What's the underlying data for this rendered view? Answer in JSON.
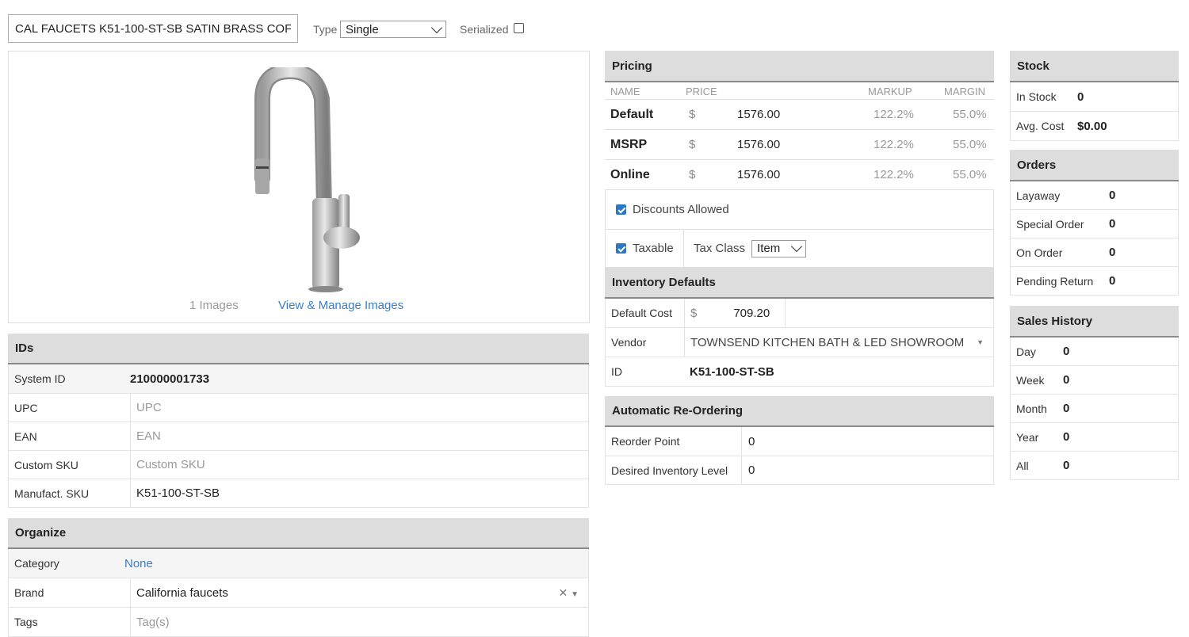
{
  "header": {
    "description_value": "CAL FAUCETS K51-100-ST-SB SATIN BRASS COF",
    "type_label": "Type",
    "type_value": "Single",
    "serialized_label": "Serialized"
  },
  "images": {
    "count_text": "1 Images",
    "manage_link": "View & Manage Images"
  },
  "ids": {
    "title": "IDs",
    "rows": [
      {
        "label": "System ID",
        "value": "210000001733"
      },
      {
        "label": "UPC",
        "placeholder": "UPC"
      },
      {
        "label": "EAN",
        "placeholder": "EAN"
      },
      {
        "label": "Custom SKU",
        "placeholder": "Custom SKU"
      },
      {
        "label": "Manufact. SKU",
        "value": "K51-100-ST-SB"
      }
    ]
  },
  "organize": {
    "title": "Organize",
    "category_label": "Category",
    "category_value": "None",
    "brand_label": "Brand",
    "brand_value": "California faucets",
    "tags_label": "Tags",
    "tags_placeholder": "Tag(s)"
  },
  "pricing": {
    "title": "Pricing",
    "columns": {
      "name": "NAME",
      "price": "PRICE",
      "markup": "MARKUP",
      "margin": "MARGIN"
    },
    "rows": [
      {
        "name": "Default",
        "currency": "$",
        "price": "1576.00",
        "markup": "122.2%",
        "margin": "55.0%"
      },
      {
        "name": "MSRP",
        "currency": "$",
        "price": "1576.00",
        "markup": "122.2%",
        "margin": "55.0%"
      },
      {
        "name": "Online",
        "currency": "$",
        "price": "1576.00",
        "markup": "122.2%",
        "margin": "55.0%"
      }
    ],
    "discounts_label": "Discounts Allowed",
    "taxable_label": "Taxable",
    "tax_class_label": "Tax Class",
    "tax_class_value": "Item"
  },
  "inventory_defaults": {
    "title": "Inventory Defaults",
    "default_cost_label": "Default Cost",
    "currency": "$",
    "default_cost_value": "709.20",
    "vendor_label": "Vendor",
    "vendor_value": "TOWNSEND KITCHEN BATH & LED SHOWROOM",
    "id_label": "ID",
    "id_value": "K51-100-ST-SB"
  },
  "reorder": {
    "title": "Automatic Re-Ordering",
    "reorder_point_label": "Reorder Point",
    "reorder_point_value": "0",
    "desired_label": "Desired Inventory Level",
    "desired_value": "0"
  },
  "stock": {
    "title": "Stock",
    "in_stock_label": "In Stock",
    "in_stock_value": "0",
    "avg_cost_label": "Avg. Cost",
    "avg_cost_value": "$0.00"
  },
  "orders": {
    "title": "Orders",
    "rows": [
      {
        "label": "Layaway",
        "value": "0"
      },
      {
        "label": "Special Order",
        "value": "0"
      },
      {
        "label": "On Order",
        "value": "0"
      },
      {
        "label": "Pending Return",
        "value": "0"
      }
    ]
  },
  "sales_history": {
    "title": "Sales History",
    "rows": [
      {
        "label": "Day",
        "value": "0"
      },
      {
        "label": "Week",
        "value": "0"
      },
      {
        "label": "Month",
        "value": "0"
      },
      {
        "label": "Year",
        "value": "0"
      },
      {
        "label": "All",
        "value": "0"
      }
    ]
  },
  "colors": {
    "accent_link": "#3b7dc4",
    "header_bg": "#dddddd",
    "checkbox": "#2a78c6"
  }
}
